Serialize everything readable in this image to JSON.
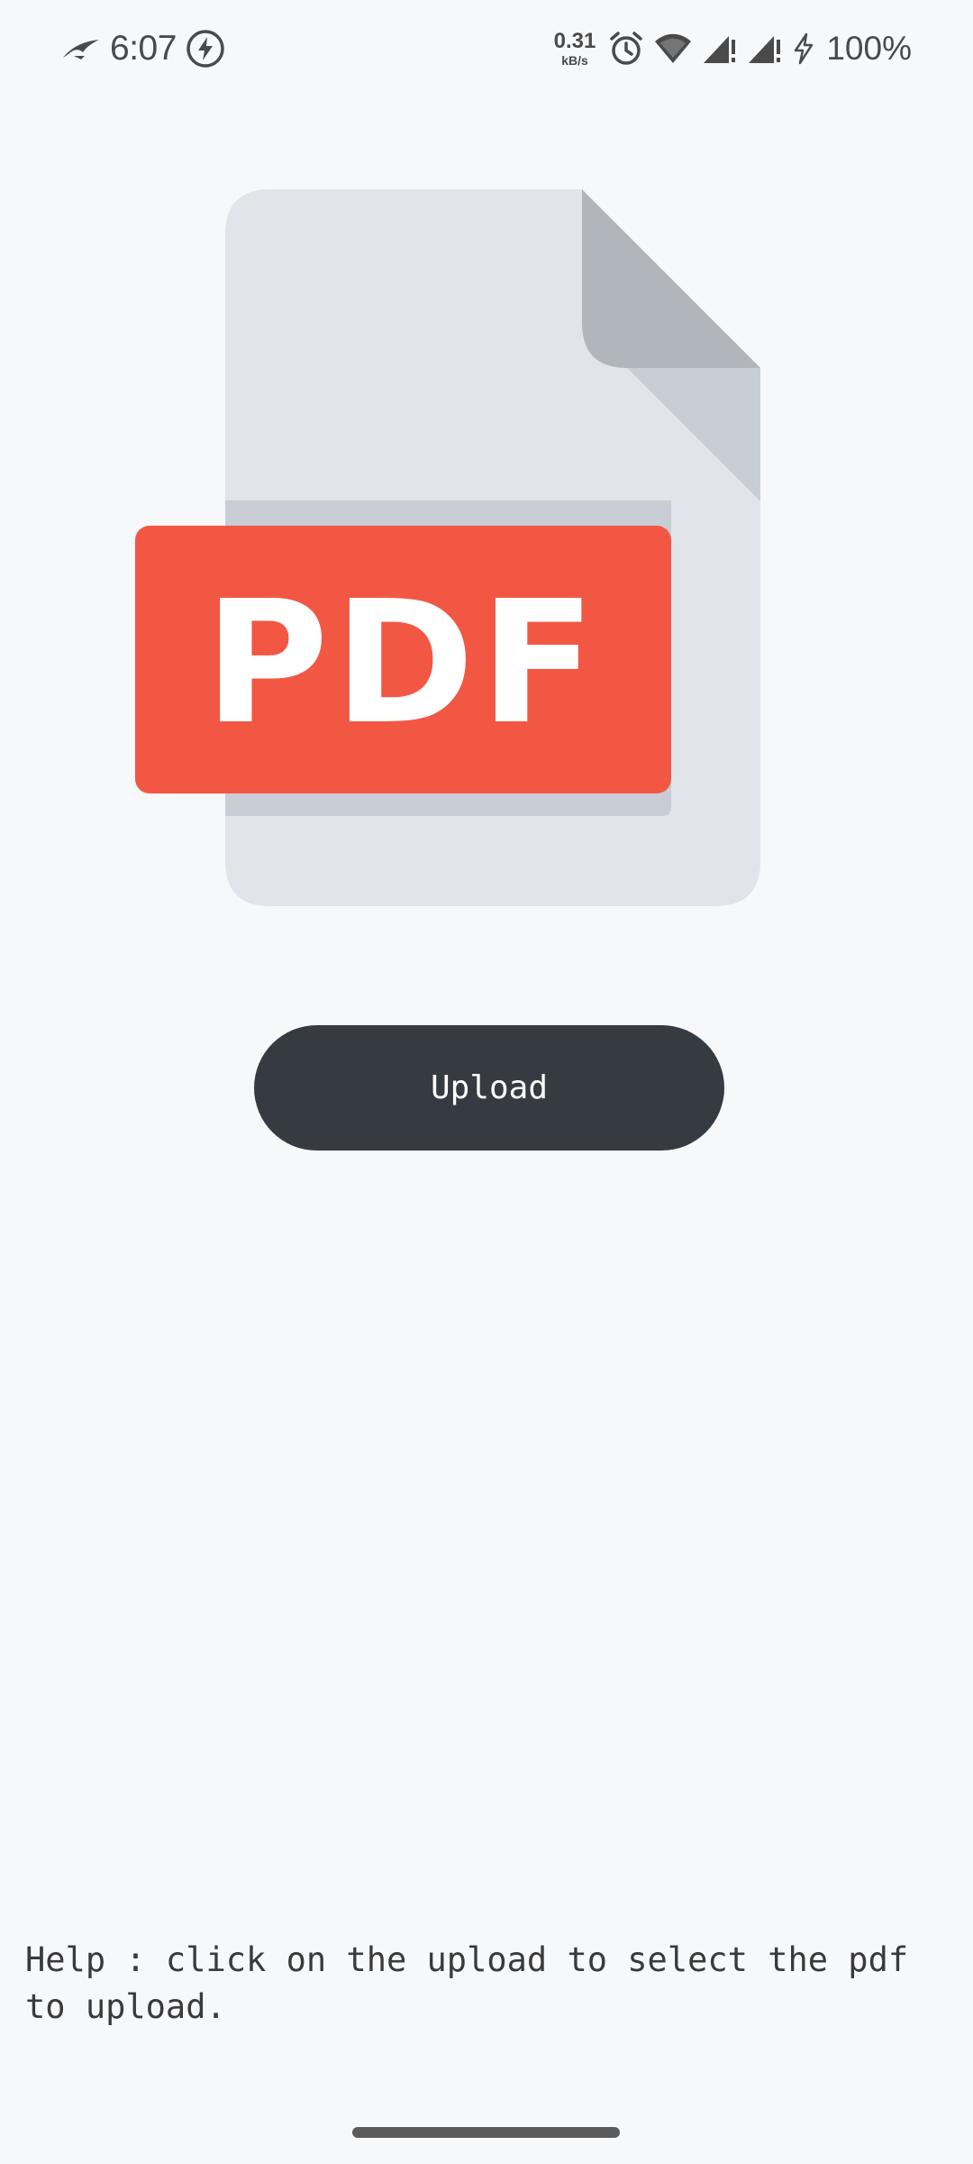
{
  "status_bar": {
    "time": "6:07",
    "net_speed_value": "0.31",
    "net_speed_unit": "kB/s",
    "battery": "100%",
    "icons": [
      "rog-logo-icon",
      "flash-circle-icon",
      "alarm-icon",
      "wifi-icon",
      "signal-icon",
      "signal-icon",
      "charging-icon"
    ]
  },
  "illustration": {
    "badge_text": "PDF",
    "icon": "pdf-file-icon",
    "colors": {
      "page": "#e1e4e8",
      "fold": "#b1b6bc",
      "fold_shadow": "#c9ced6",
      "badge": "#f25744"
    }
  },
  "upload": {
    "label": "Upload",
    "color": "#363a41"
  },
  "help": {
    "text": "Help : click on the upload to select the pdf\nto upload."
  }
}
